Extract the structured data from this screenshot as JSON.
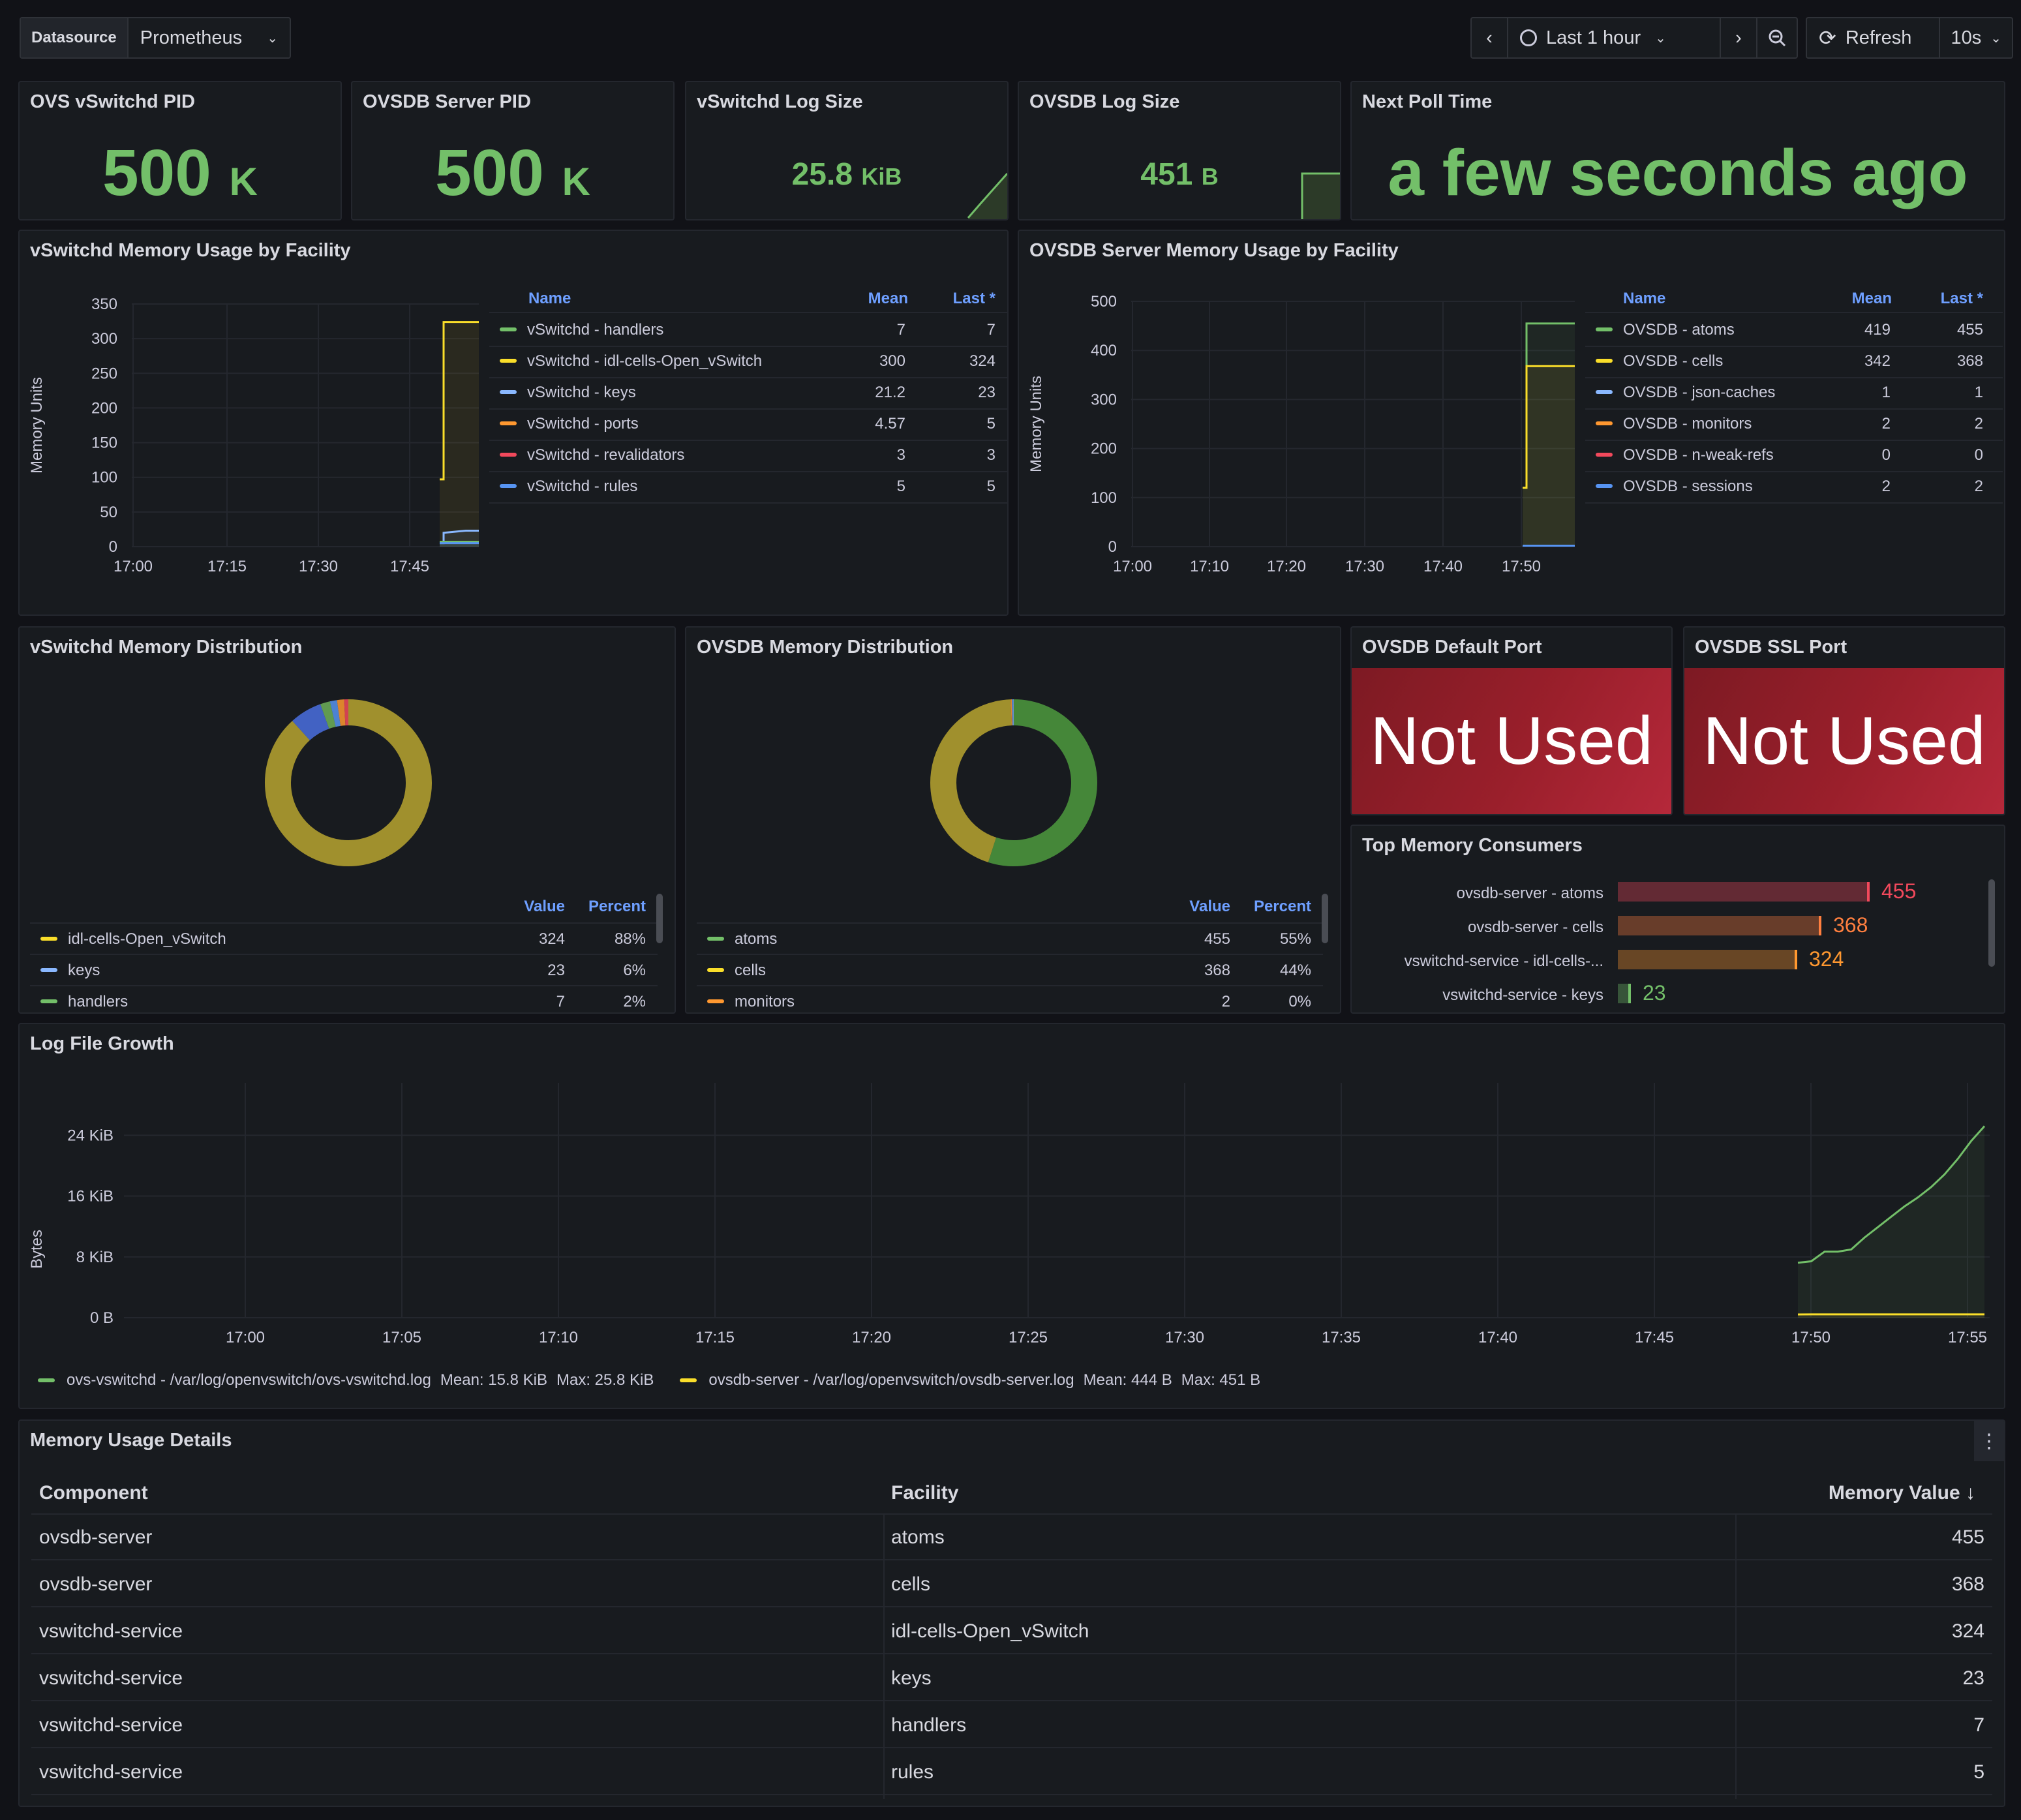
{
  "toolbar": {
    "datasource_label": "Datasource",
    "datasource_value": "Prometheus",
    "time_range": "Last 1 hour",
    "refresh_label": "Refresh",
    "refresh_interval": "10s"
  },
  "stats": {
    "vswitchd_pid": {
      "title": "OVS vSwitchd PID",
      "value": "500",
      "unit": "K"
    },
    "ovsdb_pid": {
      "title": "OVSDB Server PID",
      "value": "500",
      "unit": "K"
    },
    "vswitchd_log": {
      "title": "vSwitchd Log Size",
      "value": "25.8",
      "unit": "KiB"
    },
    "ovsdb_log": {
      "title": "OVSDB Log Size",
      "value": "451",
      "unit": "B"
    },
    "next_poll": {
      "title": "Next Poll Time",
      "value": "a few seconds ago"
    }
  },
  "vswitchd_mem": {
    "title": "vSwitchd Memory Usage by Facility",
    "ylabel": "Memory Units",
    "yticks": [
      "350",
      "300",
      "250",
      "200",
      "150",
      "100",
      "50",
      "0"
    ],
    "xticks": [
      "17:00",
      "17:15",
      "17:30",
      "17:45"
    ],
    "legend_headers": {
      "name": "Name",
      "mean": "Mean",
      "last": "Last *"
    },
    "legend": [
      {
        "name": "vSwitchd - handlers",
        "mean": "7",
        "last": "7",
        "color": "#73bf69"
      },
      {
        "name": "vSwitchd - idl-cells-Open_vSwitch",
        "mean": "300",
        "last": "324",
        "color": "#fade2a"
      },
      {
        "name": "vSwitchd - keys",
        "mean": "21.2",
        "last": "23",
        "color": "#8ab8ff"
      },
      {
        "name": "vSwitchd - ports",
        "mean": "4.57",
        "last": "5",
        "color": "#ff9830"
      },
      {
        "name": "vSwitchd - revalidators",
        "mean": "3",
        "last": "3",
        "color": "#f2495c"
      },
      {
        "name": "vSwitchd - rules",
        "mean": "5",
        "last": "5",
        "color": "#5794f2"
      }
    ]
  },
  "ovsdb_mem": {
    "title": "OVSDB Server Memory Usage by Facility",
    "ylabel": "Memory Units",
    "yticks": [
      "500",
      "400",
      "300",
      "200",
      "100",
      "0"
    ],
    "xticks": [
      "17:00",
      "17:10",
      "17:20",
      "17:30",
      "17:40",
      "17:50"
    ],
    "legend_headers": {
      "name": "Name",
      "mean": "Mean",
      "last": "Last *"
    },
    "legend": [
      {
        "name": "OVSDB - atoms",
        "mean": "419",
        "last": "455",
        "color": "#73bf69"
      },
      {
        "name": "OVSDB - cells",
        "mean": "342",
        "last": "368",
        "color": "#fade2a"
      },
      {
        "name": "OVSDB - json-caches",
        "mean": "1",
        "last": "1",
        "color": "#8ab8ff"
      },
      {
        "name": "OVSDB - monitors",
        "mean": "2",
        "last": "2",
        "color": "#ff9830"
      },
      {
        "name": "OVSDB - n-weak-refs",
        "mean": "0",
        "last": "0",
        "color": "#f2495c"
      },
      {
        "name": "OVSDB - sessions",
        "mean": "2",
        "last": "2",
        "color": "#5794f2"
      }
    ]
  },
  "vswitchd_dist": {
    "title": "vSwitchd Memory Distribution",
    "headers": {
      "value": "Value",
      "percent": "Percent"
    },
    "rows": [
      {
        "name": "idl-cells-Open_vSwitch",
        "value": "324",
        "percent": "88%",
        "color": "#fade2a"
      },
      {
        "name": "keys",
        "value": "23",
        "percent": "6%",
        "color": "#8ab8ff"
      },
      {
        "name": "handlers",
        "value": "7",
        "percent": "2%",
        "color": "#73bf69"
      }
    ]
  },
  "ovsdb_dist": {
    "title": "OVSDB Memory Distribution",
    "headers": {
      "value": "Value",
      "percent": "Percent"
    },
    "rows": [
      {
        "name": "atoms",
        "value": "455",
        "percent": "55%",
        "color": "#73bf69"
      },
      {
        "name": "cells",
        "value": "368",
        "percent": "44%",
        "color": "#fade2a"
      },
      {
        "name": "monitors",
        "value": "2",
        "percent": "0%",
        "color": "#ff9830"
      }
    ]
  },
  "ports": {
    "default": {
      "title": "OVSDB Default Port",
      "value": "Not Used"
    },
    "ssl": {
      "title": "OVSDB SSL Port",
      "value": "Not Used"
    }
  },
  "top_consumers": {
    "title": "Top Memory Consumers",
    "items": [
      {
        "label": "ovsdb-server - atoms",
        "value": "455",
        "color": "#f2495c"
      },
      {
        "label": "ovsdb-server - cells",
        "value": "368",
        "color": "#ff7f3f"
      },
      {
        "label": "vswitchd-service - idl-cells-...",
        "value": "324",
        "color": "#ff9830"
      },
      {
        "label": "vswitchd-service - keys",
        "value": "23",
        "color": "#73bf69"
      }
    ]
  },
  "log_growth": {
    "title": "Log File Growth",
    "ylabel": "Bytes",
    "yticks": [
      "24 KiB",
      "16 KiB",
      "8 KiB",
      "0 B"
    ],
    "xticks": [
      "17:00",
      "17:05",
      "17:10",
      "17:15",
      "17:20",
      "17:25",
      "17:30",
      "17:35",
      "17:40",
      "17:45",
      "17:50",
      "17:55"
    ],
    "legend": [
      {
        "text": "ovs-vswitchd - /var/log/openvswitch/ovs-vswitchd.log",
        "mean": "Mean: 15.8 KiB",
        "max": "Max: 25.8 KiB",
        "color": "#73bf69"
      },
      {
        "text": "ovsdb-server - /var/log/openvswitch/ovsdb-server.log",
        "mean": "Mean: 444 B",
        "max": "Max: 451 B",
        "color": "#fade2a"
      }
    ]
  },
  "details": {
    "title": "Memory Usage Details",
    "headers": {
      "component": "Component",
      "facility": "Facility",
      "value": "Memory Value"
    },
    "rows": [
      {
        "component": "ovsdb-server",
        "facility": "atoms",
        "value": "455"
      },
      {
        "component": "ovsdb-server",
        "facility": "cells",
        "value": "368"
      },
      {
        "component": "vswitchd-service",
        "facility": "idl-cells-Open_vSwitch",
        "value": "324"
      },
      {
        "component": "vswitchd-service",
        "facility": "keys",
        "value": "23"
      },
      {
        "component": "vswitchd-service",
        "facility": "handlers",
        "value": "7"
      },
      {
        "component": "vswitchd-service",
        "facility": "rules",
        "value": "5"
      }
    ]
  },
  "chart_data": [
    {
      "type": "line",
      "title": "vSwitchd Memory Usage by Facility",
      "ylabel": "Memory Units",
      "ylim": [
        0,
        350
      ],
      "x": [
        "17:49",
        "17:50",
        "17:55",
        "17:57"
      ],
      "series": [
        {
          "name": "vSwitchd - idl-cells-Open_vSwitch",
          "values": [
            97,
            324,
            324,
            324
          ]
        },
        {
          "name": "vSwitchd - keys",
          "values": [
            5,
            20,
            23,
            23
          ]
        },
        {
          "name": "vSwitchd - handlers",
          "values": [
            7,
            7,
            7,
            7
          ]
        },
        {
          "name": "vSwitchd - rules",
          "values": [
            5,
            5,
            5,
            5
          ]
        }
      ]
    },
    {
      "type": "line",
      "title": "OVSDB Server Memory Usage by Facility",
      "ylabel": "Memory Units",
      "ylim": [
        0,
        500
      ],
      "x": [
        "17:49",
        "17:50",
        "17:55",
        "17:57"
      ],
      "series": [
        {
          "name": "OVSDB - atoms",
          "values": [
            120,
            455,
            455,
            455
          ]
        },
        {
          "name": "OVSDB - cells",
          "values": [
            120,
            368,
            368,
            368
          ]
        },
        {
          "name": "OVSDB - sessions",
          "values": [
            2,
            2,
            2,
            2
          ]
        }
      ]
    },
    {
      "type": "pie",
      "title": "vSwitchd Memory Distribution",
      "categories": [
        "idl-cells-Open_vSwitch",
        "keys",
        "handlers",
        "rules",
        "ports",
        "revalidators"
      ],
      "values": [
        324,
        23,
        7,
        5,
        5,
        3
      ]
    },
    {
      "type": "pie",
      "title": "OVSDB Memory Distribution",
      "categories": [
        "atoms",
        "cells",
        "monitors",
        "sessions",
        "json-caches"
      ],
      "values": [
        455,
        368,
        2,
        2,
        1
      ]
    },
    {
      "type": "bar",
      "title": "Top Memory Consumers",
      "categories": [
        "ovsdb-server - atoms",
        "ovsdb-server - cells",
        "vswitchd-service - idl-cells-...",
        "vswitchd-service - keys"
      ],
      "values": [
        455,
        368,
        324,
        23
      ]
    },
    {
      "type": "area",
      "title": "Log File Growth",
      "ylabel": "Bytes",
      "ylim": [
        0,
        29000
      ],
      "x": [
        "17:50",
        "17:50:30",
        "17:51",
        "17:51:30",
        "17:52",
        "17:52:30",
        "17:53",
        "17:53:30",
        "17:54",
        "17:54:30",
        "17:55",
        "17:55:30",
        "17:56",
        "17:56:30",
        "17:57"
      ],
      "series": [
        {
          "name": "ovs-vswitchd - /var/log/openvswitch/ovs-vswitchd.log",
          "values": [
            7400,
            7600,
            8900,
            8900,
            9200,
            10800,
            12200,
            13600,
            15000,
            16200,
            17600,
            19300,
            21400,
            23800,
            25800
          ]
        },
        {
          "name": "ovsdb-server - /var/log/openvswitch/ovsdb-server.log",
          "values": [
            444,
            445,
            446,
            447,
            448,
            448,
            449,
            449,
            450,
            450,
            450,
            451,
            451,
            451,
            451
          ]
        }
      ]
    }
  ]
}
